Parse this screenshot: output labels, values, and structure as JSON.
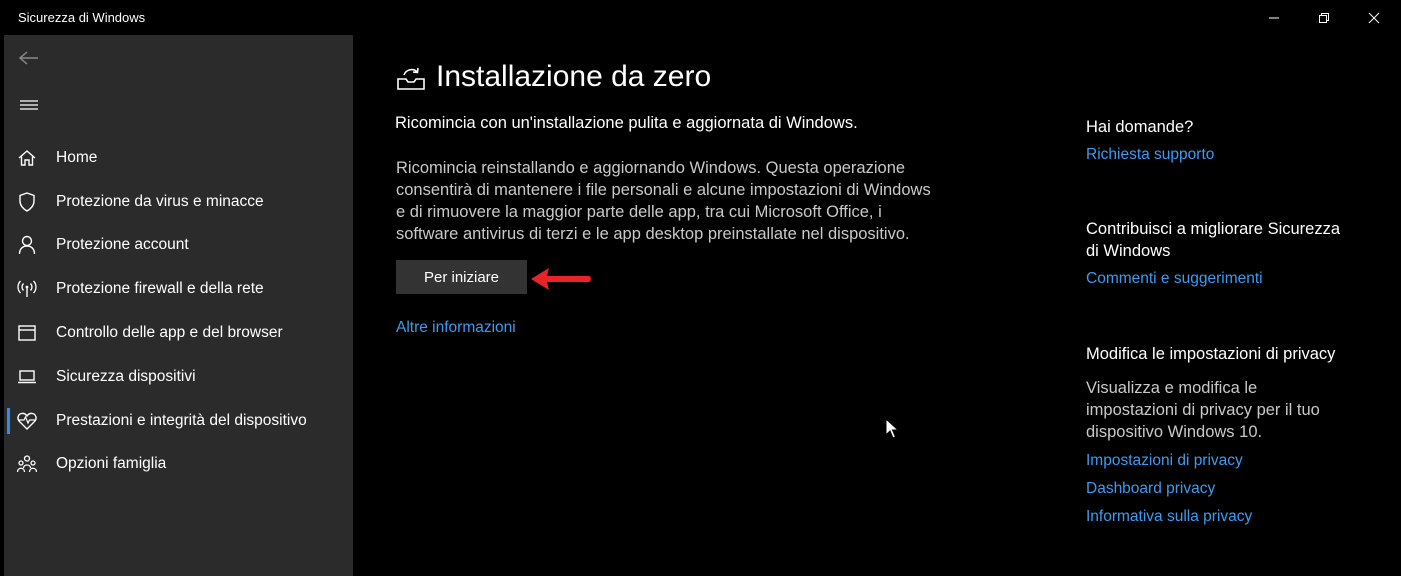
{
  "window": {
    "title": "Sicurezza di Windows"
  },
  "sidebar": {
    "items": [
      {
        "label": "Home",
        "icon": "home-icon"
      },
      {
        "label": "Protezione da virus e minacce",
        "icon": "shield-icon"
      },
      {
        "label": "Protezione account",
        "icon": "person-icon"
      },
      {
        "label": "Protezione firewall e della rete",
        "icon": "wifi-antenna-icon"
      },
      {
        "label": "Controllo delle app e del browser",
        "icon": "app-window-icon"
      },
      {
        "label": "Sicurezza dispositivi",
        "icon": "laptop-icon"
      },
      {
        "label": "Prestazioni e integrità del dispositivo",
        "icon": "heart-pulse-icon",
        "selected": true
      },
      {
        "label": "Opzioni famiglia",
        "icon": "family-icon"
      }
    ]
  },
  "main": {
    "title": "Installazione da zero",
    "subtitle": "Ricomincia con un'installazione pulita e aggiornata di Windows.",
    "description": "Ricomincia reinstallando e aggiornando Windows. Questa operazione consentirà di mantenere i file personali e alcune impostazioni di Windows e di rimuovere la maggior parte delle app, tra cui Microsoft Office, i software antivirus di terzi e le app desktop preinstallate nel dispositivo.",
    "start_button": "Per iniziare",
    "more_info_link": "Altre informazioni"
  },
  "side_panel": {
    "questions": {
      "heading": "Hai domande?",
      "link": "Richiesta supporto"
    },
    "feedback": {
      "heading": "Contribuisci a migliorare Sicurezza di Windows",
      "link": "Commenti e suggerimenti"
    },
    "privacy": {
      "heading": "Modifica le impostazioni di privacy",
      "text": "Visualizza e modifica le impostazioni di privacy per il tuo dispositivo Windows 10.",
      "links": [
        "Impostazioni di privacy",
        "Dashboard privacy",
        "Informativa sulla privacy"
      ]
    }
  },
  "colors": {
    "background": "#000000",
    "sidebar": "#2b2b2b",
    "link": "#3c9bf0",
    "accent": "#2e8ff0",
    "annotation_arrow": "#e8232a"
  }
}
